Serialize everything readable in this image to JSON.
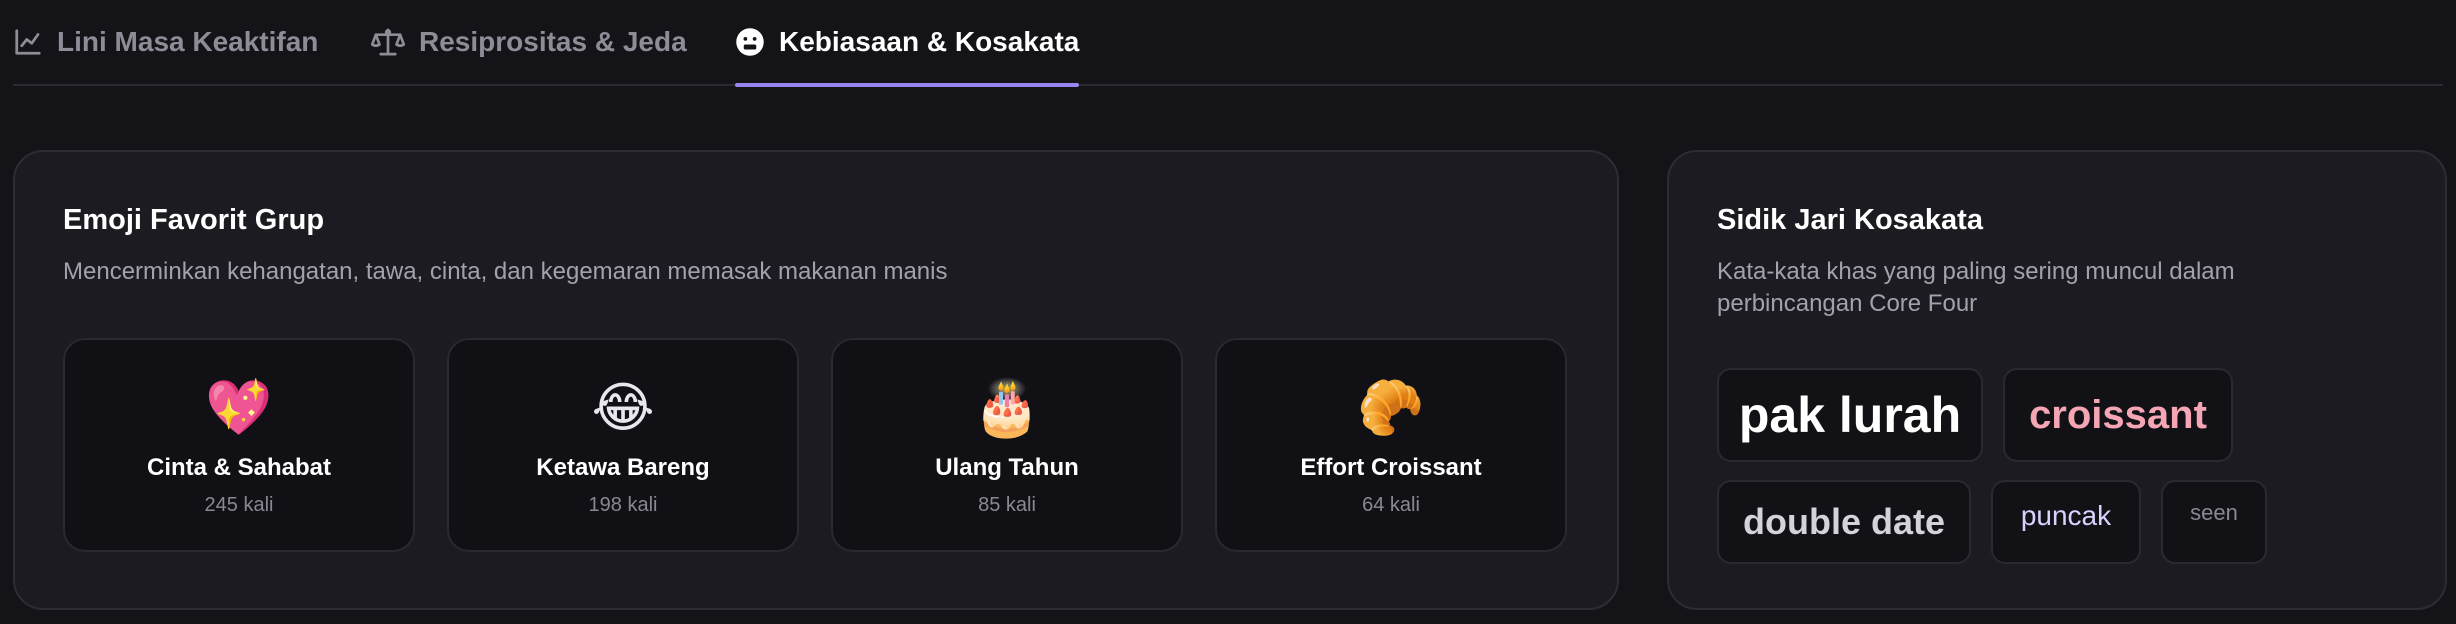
{
  "tabs": [
    {
      "label": "Lini Masa Keaktifan",
      "icon": "line-chart-icon"
    },
    {
      "label": "Resiprositas & Jeda",
      "icon": "scale-icon"
    },
    {
      "label": "Kebiasaan & Kosakata",
      "icon": "face-icon",
      "active": true
    }
  ],
  "emoji_card": {
    "title": "Emoji Favorit Grup",
    "subtitle": "Mencerminkan kehangatan, tawa, cinta, dan kegemaran memasak makanan manis",
    "items": [
      {
        "emoji": "💖",
        "label": "Cinta & Sahabat",
        "count": "245 kali"
      },
      {
        "emoji": "😂",
        "label": "Ketawa Bareng",
        "count": "198 kali"
      },
      {
        "emoji": "🎂",
        "label": "Ulang Tahun",
        "count": "85 kali"
      },
      {
        "emoji": "🥐",
        "label": "Effort Croissant",
        "count": "64 kali"
      }
    ]
  },
  "vocab_card": {
    "title": "Sidik Jari Kosakata",
    "subtitle": "Kata-kata khas yang paling sering muncul dalam perbincangan Core Four",
    "words": [
      {
        "text": "pak lurah",
        "color": "#ffffff"
      },
      {
        "text": "croissant",
        "color": "#f4a6b4"
      },
      {
        "text": "double date",
        "color": "#d4d2da"
      },
      {
        "text": "puncak",
        "color": "#d9d2ff"
      },
      {
        "text": "seen",
        "color": "#8a8893"
      }
    ]
  }
}
